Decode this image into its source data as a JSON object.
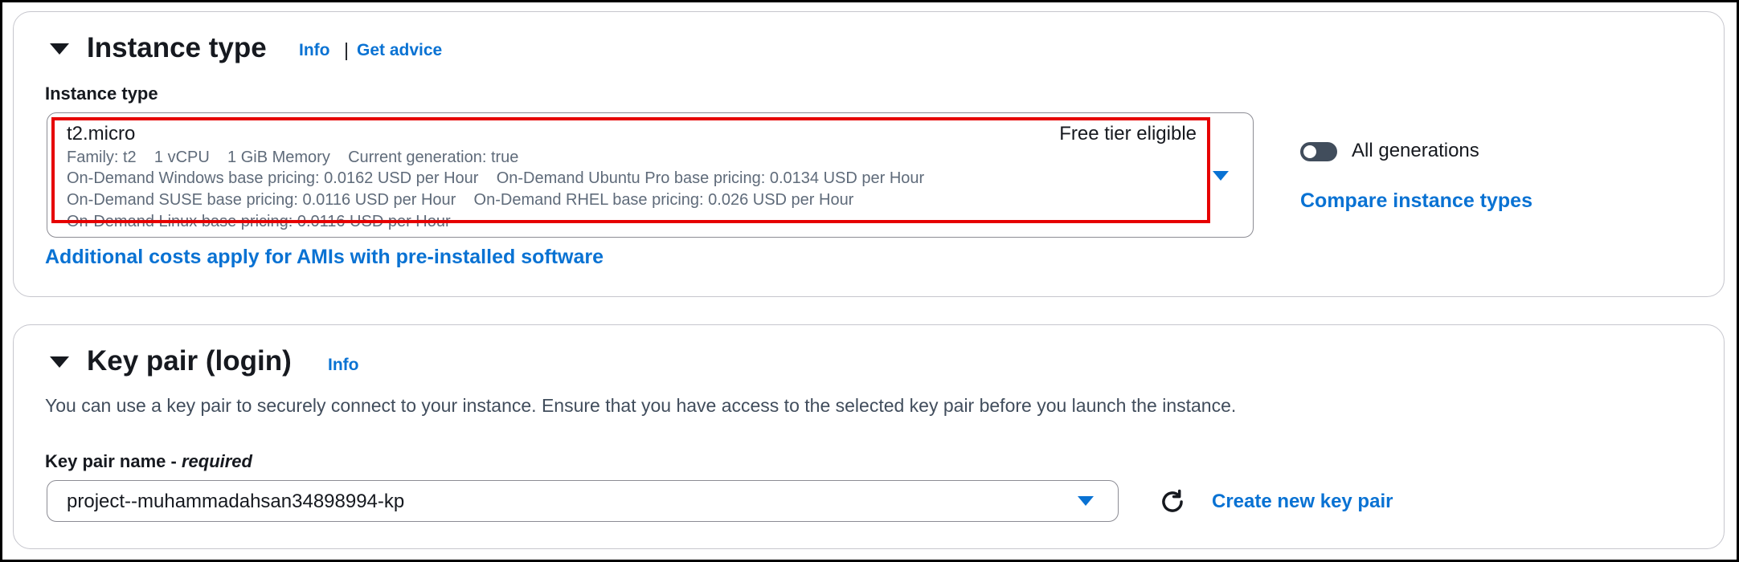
{
  "instance_section": {
    "title": "Instance type",
    "info": "Info",
    "separator": "|",
    "get_advice": "Get advice",
    "field_label": "Instance type",
    "selected": {
      "name": "t2.micro",
      "badge": "Free tier eligible",
      "specs": "Family: t2    1 vCPU    1 GiB Memory    Current generation: true",
      "pricing_line1": "On-Demand Windows base pricing: 0.0162 USD per Hour    On-Demand Ubuntu Pro base pricing: 0.0134 USD per Hour",
      "pricing_line2": "On-Demand SUSE base pricing: 0.0116 USD per Hour    On-Demand RHEL base pricing: 0.026 USD per Hour",
      "pricing_line3": "On-Demand Linux base pricing: 0.0116 USD per Hour"
    },
    "toggle_label": "All generations",
    "toggle_on": false,
    "compare_link": "Compare instance types",
    "costs_link": "Additional costs apply for AMIs with pre-installed software"
  },
  "keypair_section": {
    "title": "Key pair (login)",
    "info": "Info",
    "description": "You can use a key pair to securely connect to your instance. Ensure that you have access to the selected key pair before you launch the instance.",
    "field_label": "Key pair name - ",
    "field_required": "required",
    "selected_value": "project--muhammadahsan34898994-kp",
    "create_link": "Create new key pair"
  },
  "colors": {
    "link": "#0972d3",
    "highlight": "#e60000",
    "text": "#16191f",
    "secondary_text": "#5f6b7a"
  }
}
